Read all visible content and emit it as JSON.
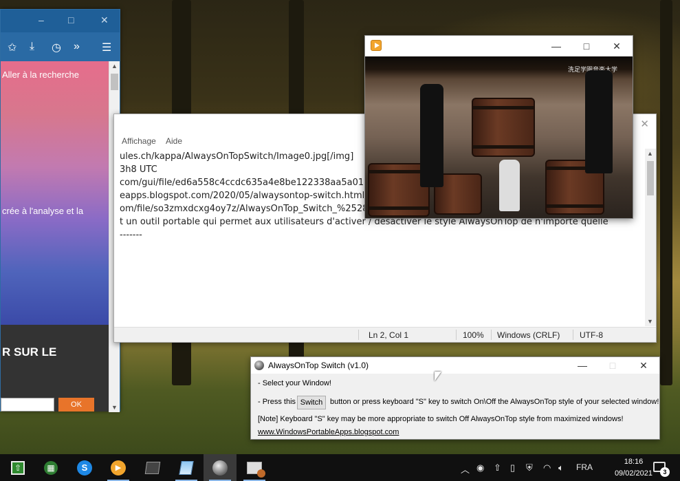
{
  "browser": {
    "search_text": "Aller à la recherche",
    "body_text": "crée à l'analyse et la",
    "cta_text": "R SUR LE",
    "ok_label": "OK",
    "title_controls": {
      "minimize": "–",
      "maximize": "□",
      "close": "✕"
    }
  },
  "notepad": {
    "menu": [
      "Affichage",
      "Aide"
    ],
    "lines": [
      "ules.ch/kappa/AlwaysOnTopSwitch/Image0.jpg[/img]",
      "",
      "",
      "",
      "",
      "3h8 UTC",
      "com/gui/file/ed6a558c4ccdc635a4e8be122338aa5a011c6315db1cf25dc21aaacaed343c5c/detection",
      "eapps.blogspot.com/2020/05/alwaysontop-switch.html",
      "om/file/so3zmxdcxg4oy7z/AlwaysOnTop_Switch_%2528v1.0%2529.rar/file",
      "t un outil portable qui permet aux utilisateurs d'activer / désactiver le style AlwaysOnTop de n'importe quelle",
      "",
      "",
      "-------"
    ],
    "status": {
      "position": "Ln 2, Col 1",
      "zoom": "100%",
      "eol": "Windows (CRLF)",
      "encoding": "UTF-8"
    }
  },
  "video": {
    "watermark": "洗足学園音楽大学",
    "controls": {
      "minimize": "—",
      "maximize": "□",
      "close": "✕"
    }
  },
  "app": {
    "title": "AlwaysOnTop Switch (v1.0)",
    "line1": "- Select your Window!",
    "line2_prefix": "- Press this",
    "switch_label": "Switch",
    "line2_suffix": "button or press keyboard \"S\" key to switch On\\Off the AlwaysOnTop style of your selected window!",
    "note": "[Note] Keyboard \"S\" key may be more appropriate to switch Off AlwaysOnTop style from maximized windows!",
    "link": "www.WindowsPortableApps.blogspot.com",
    "controls": {
      "minimize": "—",
      "maximize": "□",
      "close": "✕"
    }
  },
  "taskbar": {
    "language": "FRA",
    "time": "18:16",
    "date": "09/02/2021",
    "notifications": "3"
  },
  "colors": {
    "taskbar": "#101010",
    "browser_titlebar": "#1f5f98",
    "link": "#0645ad"
  }
}
